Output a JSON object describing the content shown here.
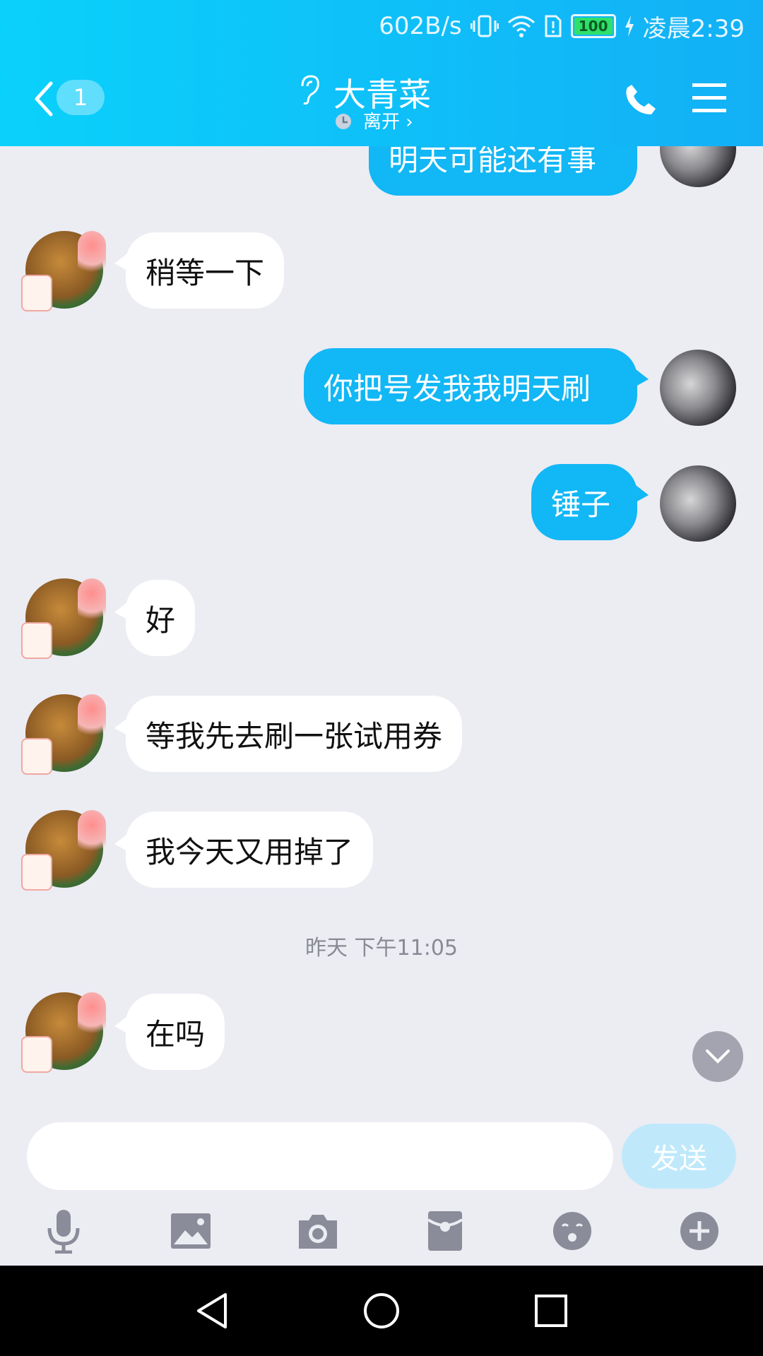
{
  "status_bar": {
    "net_speed": "602B/s",
    "battery": "100",
    "time": "凌晨2:39"
  },
  "header": {
    "unread_count": "1",
    "contact_name": "大青菜",
    "presence": "离开 ›"
  },
  "messages": [
    {
      "dir": "out",
      "text": "明天可能还有事"
    },
    {
      "dir": "in",
      "text": "稍等一下"
    },
    {
      "dir": "out",
      "text": "你把号发我我明天刷"
    },
    {
      "dir": "out",
      "text": "锤子"
    },
    {
      "dir": "in",
      "text": "好"
    },
    {
      "dir": "in",
      "text": "等我先去刷一张试用券"
    },
    {
      "dir": "in",
      "text": "我今天又用掉了"
    },
    {
      "dir": "in",
      "text": "在吗"
    }
  ],
  "timestamp": "昨天 下午11:05",
  "input": {
    "value": "",
    "placeholder": ""
  },
  "send_label": "发送",
  "toolbar_icons": [
    "microphone-icon",
    "image-icon",
    "camera-icon",
    "red-packet-icon",
    "emoji-icon",
    "plus-icon"
  ],
  "colors": {
    "header_start": "#0ad1fb",
    "header_end": "#13b0f6",
    "outgoing_bubble": "#12b7f5",
    "incoming_bubble": "#ffffff",
    "background": "#ececf3"
  }
}
